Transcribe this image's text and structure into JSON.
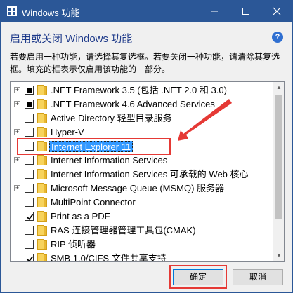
{
  "window": {
    "title": "Windows 功能"
  },
  "header": {
    "heading": "启用或关闭 Windows 功能",
    "description": "若要启用一种功能，请选择其复选框。若要关闭一种功能，请清除其复选框。填充的框表示仅启用该功能的一部分。"
  },
  "features": [
    {
      "label": ".NET Framework 3.5 (包括 .NET 2.0 和 3.0)",
      "expandable": true,
      "state": "partial"
    },
    {
      "label": ".NET Framework 4.6 Advanced Services",
      "expandable": true,
      "state": "partial"
    },
    {
      "label": "Active Directory 轻型目录服务",
      "expandable": false,
      "state": "unchecked"
    },
    {
      "label": "Hyper-V",
      "expandable": true,
      "state": "unchecked"
    },
    {
      "label": "Internet Explorer 11",
      "expandable": false,
      "state": "unchecked",
      "selected": true
    },
    {
      "label": "Internet Information Services",
      "expandable": true,
      "state": "unchecked"
    },
    {
      "label": "Internet Information Services 可承载的 Web 核心",
      "expandable": false,
      "state": "unchecked"
    },
    {
      "label": "Microsoft Message Queue (MSMQ) 服务器",
      "expandable": true,
      "state": "unchecked"
    },
    {
      "label": "MultiPoint Connector",
      "expandable": false,
      "state": "unchecked"
    },
    {
      "label": "Print as a PDF",
      "expandable": false,
      "state": "checked"
    },
    {
      "label": "RAS 连接管理器管理工具包(CMAK)",
      "expandable": false,
      "state": "unchecked"
    },
    {
      "label": "RIP 侦听器",
      "expandable": false,
      "state": "unchecked"
    },
    {
      "label": "SMB 1.0/CIFS 文件共享支持",
      "expandable": false,
      "state": "checked"
    }
  ],
  "buttons": {
    "ok": "确定",
    "cancel": "取消"
  },
  "colors": {
    "title_bar": "#2b5797",
    "selection": "#3399ff",
    "annotation": "#e53935"
  }
}
